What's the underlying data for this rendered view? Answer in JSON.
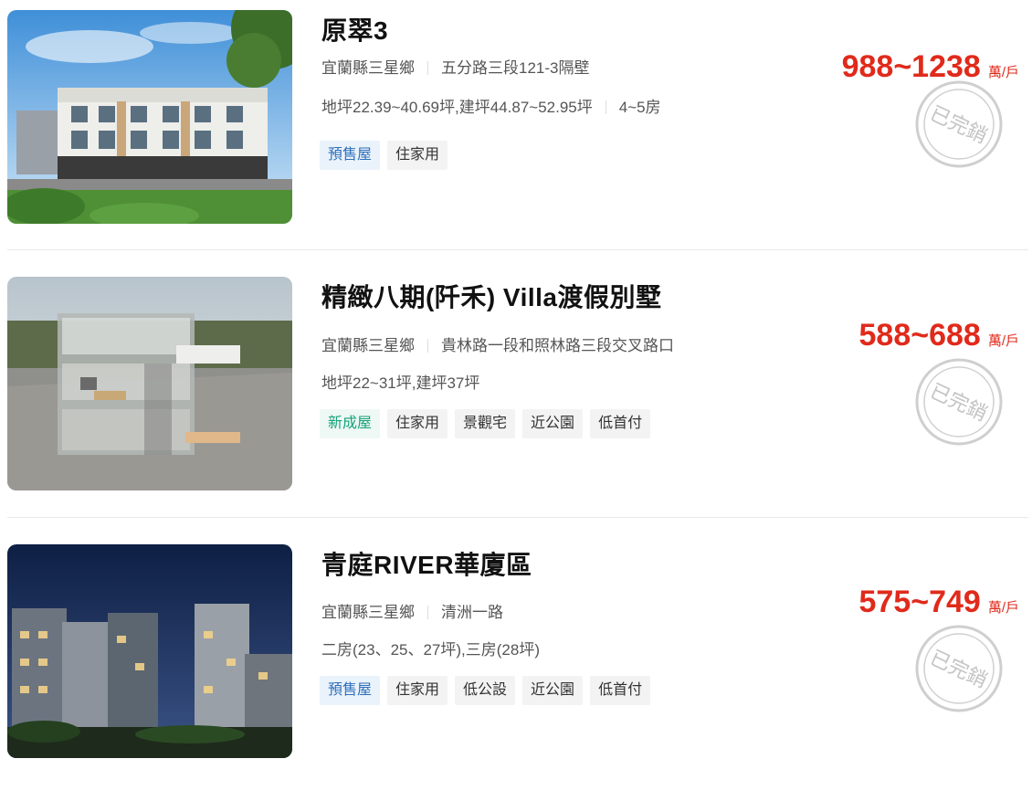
{
  "listings": [
    {
      "title": "原翠3",
      "district": "宜蘭縣三星鄉",
      "address": "五分路三段121-3隔壁",
      "specs": "地坪22.39~40.69坪,建坪44.87~52.95坪",
      "rooms": "4~5房",
      "tags": [
        "預售屋",
        "住家用"
      ],
      "price": "988~1238",
      "price_unit": "萬/戶",
      "stamp_text": "已完銷"
    },
    {
      "title": "精緻八期(阡禾) Villa渡假別墅",
      "district": "宜蘭縣三星鄉",
      "address": "貴林路一段和照林路三段交叉路口",
      "specs": "地坪22~31坪,建坪37坪",
      "tags": [
        "新成屋",
        "住家用",
        "景觀宅",
        "近公園",
        "低首付"
      ],
      "price": "588~688",
      "price_unit": "萬/戶",
      "stamp_text": "已完銷"
    },
    {
      "title": "青庭RIVER華廈區",
      "district": "宜蘭縣三星鄉",
      "address": "清洲一路",
      "specs": "二房(23、25、27坪),三房(28坪)",
      "tags": [
        "預售屋",
        "住家用",
        "低公設",
        "近公園",
        "低首付"
      ],
      "price": "575~749",
      "price_unit": "萬/戶",
      "stamp_text": "已完銷"
    }
  ],
  "colors": {
    "price": "#e02a1b",
    "presale_tag": "#2e6fba",
    "new_tag": "#17a37a",
    "stamp": "#c8c8c8"
  }
}
